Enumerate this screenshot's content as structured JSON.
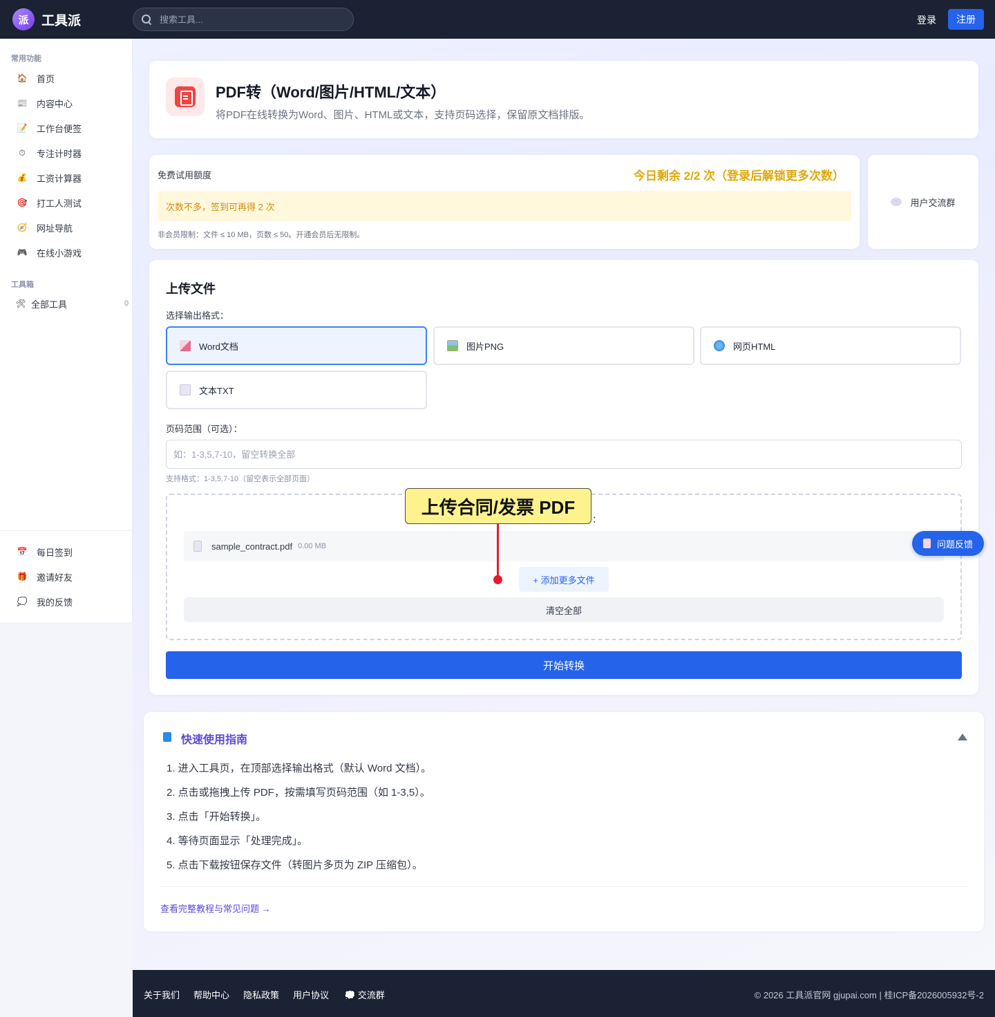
{
  "app": {
    "name": "工具派",
    "logo_glyph": "派"
  },
  "search": {
    "placeholder": "搜索工具..."
  },
  "header": {
    "login": "登录",
    "register": "注册"
  },
  "sidebar": {
    "section_common": "常用功能",
    "items": [
      {
        "label": "首页",
        "icon": "home-icon",
        "glyph": "🏠"
      },
      {
        "label": "内容中心",
        "icon": "newspaper-icon",
        "glyph": "📰"
      },
      {
        "label": "工作台便签",
        "icon": "memo-icon",
        "glyph": "📝"
      },
      {
        "label": "专注计时器",
        "icon": "stopwatch-icon",
        "glyph": "⏱"
      },
      {
        "label": "工资计算器",
        "icon": "money-bag-icon",
        "glyph": "💰"
      },
      {
        "label": "打工人测试",
        "icon": "target-icon",
        "glyph": "🎯"
      },
      {
        "label": "网址导航",
        "icon": "compass-icon",
        "glyph": "🧭"
      },
      {
        "label": "在线小游戏",
        "icon": "gamepad-icon",
        "glyph": "🎮"
      }
    ],
    "section_tools": "工具箱",
    "all_tools": {
      "label": "全部工具",
      "count": "0",
      "glyph": "🛠"
    },
    "bottom_items": [
      {
        "label": "每日签到",
        "icon": "calendar-icon",
        "glyph": "📅"
      },
      {
        "label": "邀请好友",
        "icon": "gift-icon",
        "glyph": "🎁"
      },
      {
        "label": "我的反馈",
        "icon": "speech-bubble-icon",
        "glyph": "💭"
      }
    ]
  },
  "page": {
    "title": "PDF转（Word/图片/HTML/文本）",
    "description": "将PDF在线转换为Word、图片、HTML或文本，支持页码选择，保留原文档排版。"
  },
  "quota": {
    "label": "免费试用额度",
    "remaining": "今日剩余 2/2 次（登录后解锁更多次数）",
    "tip": "次数不多，签到可再得 2 次",
    "note": "非会员限制：文件 ≤ 10 MB，页数 ≤ 50。开通会员后无限制。"
  },
  "community": {
    "label": "用户交流群"
  },
  "upload": {
    "title": "上传文件",
    "format_label": "选择输出格式：",
    "formats": [
      {
        "label": "Word文档",
        "active": true
      },
      {
        "label": "图片PNG",
        "active": false
      },
      {
        "label": "网页HTML",
        "active": false
      },
      {
        "label": "文本TXT",
        "active": false
      }
    ],
    "range_label": "页码范围（可选）：",
    "range_placeholder": "如：1-3,5,7-10，留空转换全部",
    "range_hint": "支持格式：1-3,5,7-10（留空表示全部页面）",
    "dropzone_colon": "：",
    "file": {
      "name": "sample_contract.pdf",
      "size": "0.00 MB"
    },
    "add_more": "+ 添加更多文件",
    "clear_all": "清空全部",
    "start": "开始转换"
  },
  "annotation": {
    "callout": "上传合同/发票 PDF",
    "color": "#e11d2d"
  },
  "feedback": {
    "label": "问题反馈"
  },
  "guide": {
    "title": "快速使用指南",
    "steps": [
      "1. 进入工具页，在顶部选择输出格式（默认 Word 文档）。",
      "2. 点击或拖拽上传 PDF，按需填写页码范围（如 1-3,5）。",
      "3. 点击「开始转换」。",
      "4. 等待页面显示「处理完成」。",
      "5. 点击下载按钮保存文件（转图片多页为 ZIP 压缩包）。"
    ],
    "link": "查看完整教程与常见问题 →"
  },
  "footer": {
    "links": [
      "关于我们",
      "帮助中心",
      "隐私政策",
      "用户协议",
      "💭 交流群"
    ],
    "copyright": "© 2026 工具派官网 gjupai.com | 桂ICP备2026005932号-2"
  },
  "colors": {
    "accent": "#2563eb",
    "topbar": "#1a2233",
    "quota": "#e0a80c",
    "guide": "#5b4ad6"
  }
}
